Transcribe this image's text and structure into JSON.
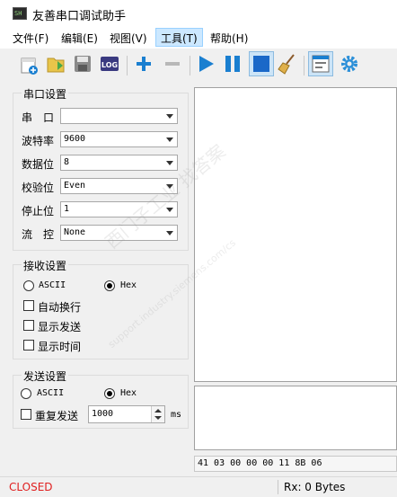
{
  "window": {
    "title": "友善串口调试助手",
    "app_icon_text": "SH"
  },
  "menu": [
    "文件(F)",
    "编辑(E)",
    "视图(V)",
    "工具(T)",
    "帮助(H)"
  ],
  "toolbar": {
    "log_label": "LOG",
    "buttons": [
      "new-icon",
      "open-icon",
      "save-icon",
      "log-icon",
      "add-icon",
      "remove-icon",
      "play-icon",
      "pause-icon",
      "stop-icon",
      "clear-icon",
      "layout-icon",
      "settings-icon"
    ]
  },
  "serial": {
    "title": "串口设置",
    "port_label": "串　口",
    "port_value": "",
    "baud_label": "波特率",
    "baud_value": "9600",
    "databits_label": "数据位",
    "databits_value": "8",
    "parity_label": "校验位",
    "parity_value": "Even",
    "stopbits_label": "停止位",
    "stopbits_value": "1",
    "flow_label": "流　控",
    "flow_value": "None"
  },
  "receive": {
    "title": "接收设置",
    "ascii_label": "ASCII",
    "hex_label": "Hex",
    "selected": "Hex",
    "auto_wrap_label": "自动换行",
    "show_send_label": "显示发送",
    "show_time_label": "显示时间"
  },
  "send": {
    "title": "发送设置",
    "ascii_label": "ASCII",
    "hex_label": "Hex",
    "selected": "Hex",
    "repeat_label": "重复发送",
    "repeat_interval": "1000",
    "unit": "ms"
  },
  "send_line": "41 03 00 00 00 11 8B 06",
  "status": {
    "connection": "CLOSED",
    "rx": "Rx: 0 Bytes"
  },
  "watermark": {
    "line1": "西门子工业 找答案",
    "line2": "support.industry.siemens.com/cs"
  },
  "colors": {
    "accent_blue": "#1a7fd0",
    "closed_red": "#e02020"
  }
}
